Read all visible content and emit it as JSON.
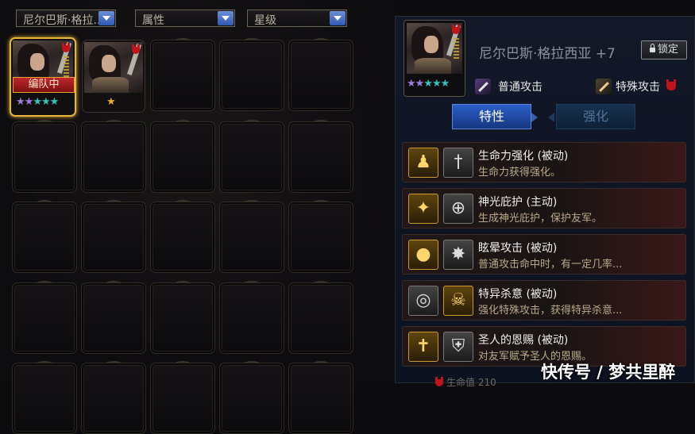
{
  "filters": {
    "hero_filter": "尼尔巴斯·格拉...",
    "attribute_filter": "属性",
    "star_filter": "星级"
  },
  "heroes": [
    {
      "team_badge": "编队中",
      "stars_purple": 2,
      "stars_teal": 3,
      "selected": true
    },
    {
      "stars_gold": 1
    }
  ],
  "detail": {
    "hero_name": "尼尔巴斯·格拉西亚 +7",
    "lock_label": "锁定",
    "stars_purple": 2,
    "stars_teal": 3,
    "normal_attack_label": "普通攻击",
    "special_attack_label": "特殊攻击",
    "tabs": {
      "traits": "特性",
      "enhance": "强化"
    },
    "skills": [
      {
        "name": "生命力强化 (被动)",
        "desc": "生命力获得强化。"
      },
      {
        "name": "神光庇护 (主动)",
        "desc": "生成神光庇护，保护友军。"
      },
      {
        "name": "眩晕攻击 (被动)",
        "desc": "普通攻击命中时，有一定几率..."
      },
      {
        "name": "特异杀意 (被动)",
        "desc": "强化特殊攻击，获得特异杀意..."
      },
      {
        "name": "圣人的恩赐 (被动)",
        "desc": "对友军赋予圣人的恩赐。"
      }
    ],
    "bottom_stat_label": "生命值",
    "bottom_stat_value": "210"
  },
  "watermark": "快传号 / 梦共里醉",
  "colors": {
    "accent_blue": "#2b5fc9",
    "badge_red": "#c0282b",
    "gold_frame": "#e7b53a"
  }
}
